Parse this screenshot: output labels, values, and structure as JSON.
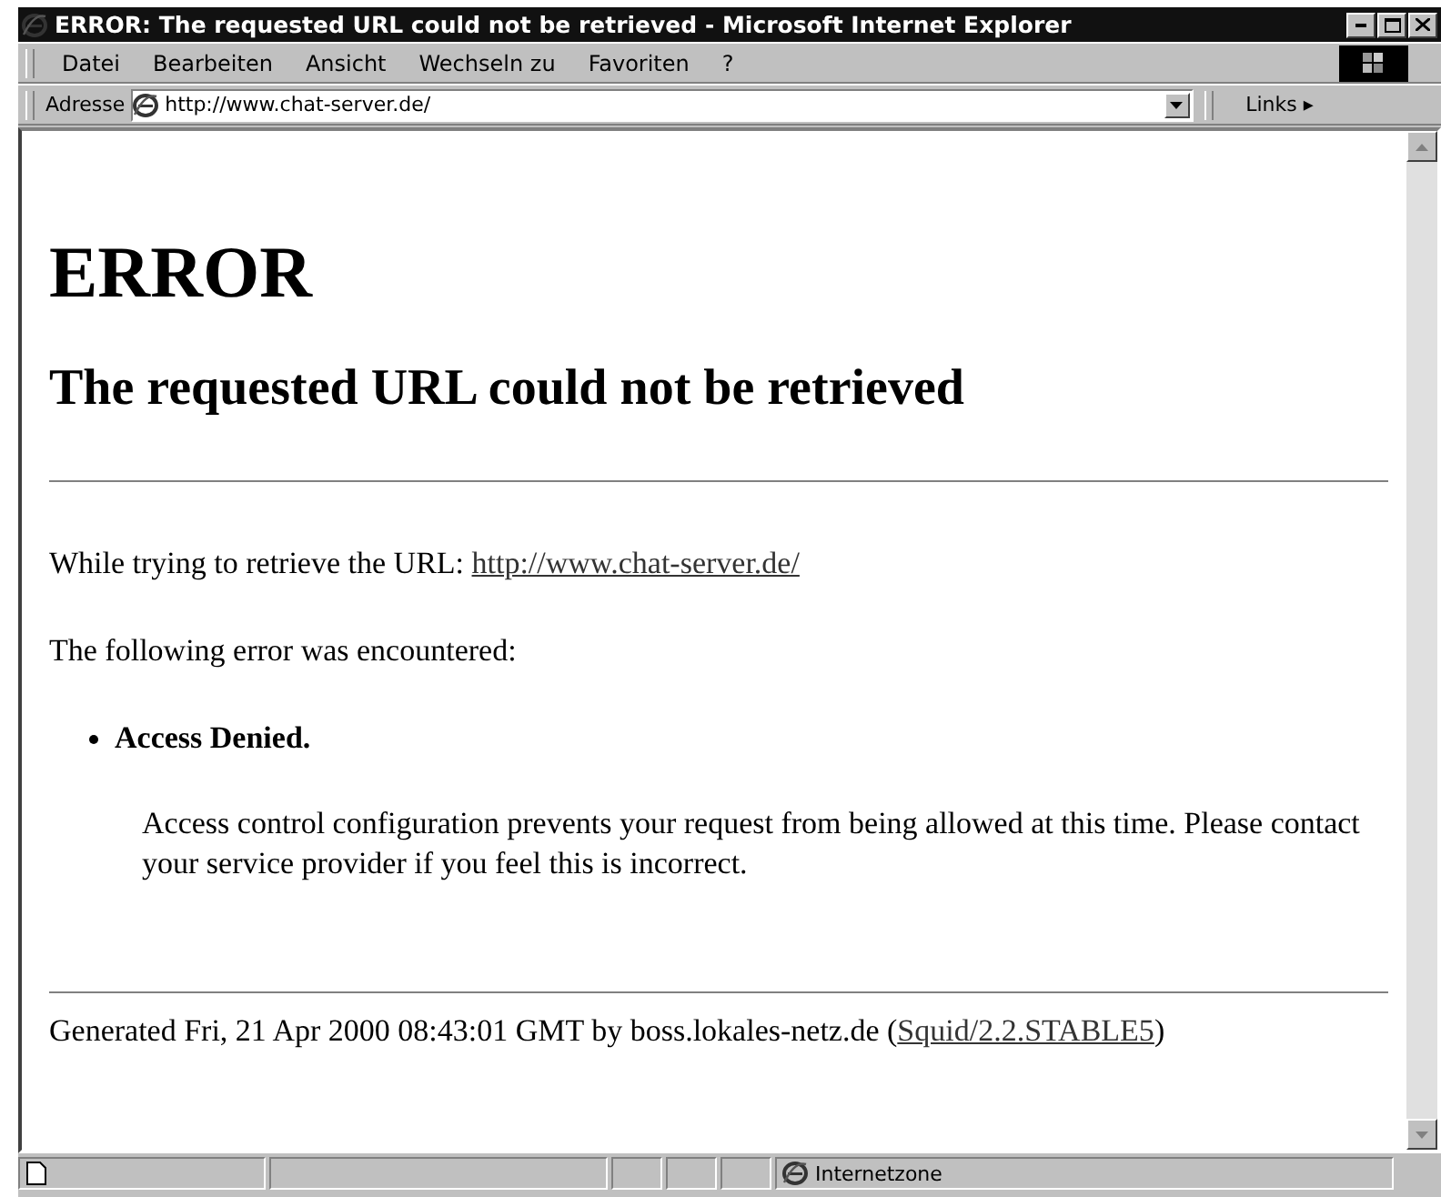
{
  "window": {
    "title": "ERROR: The requested URL could not be retrieved - Microsoft Internet Explorer"
  },
  "menu": [
    "Datei",
    "Bearbeiten",
    "Ansicht",
    "Wechseln zu",
    "Favoriten",
    "?"
  ],
  "address_bar": {
    "label": "Adresse",
    "value": "http://www.chat-server.de/",
    "links": "Links",
    "links_arrow": "▸"
  },
  "page": {
    "heading": "ERROR",
    "subheading": "The requested URL could not be retrieved",
    "url_line": {
      "text": "While trying to retrieve the URL:",
      "link": "http://www.chat-server.de/"
    },
    "error_intro": "The following error was encountered:",
    "error_title": "Access Denied.",
    "error_text": "Access control configuration prevents your request from being allowed at this time. Please contact your service provider if you feel this is incorrect.",
    "footer": {
      "text": "Generated Fri, 21 Apr 2000 08:43:01 GMT by boss.lokales-netz.de (",
      "link": "Squid/2.2.STABLE5",
      "after": ")"
    }
  },
  "status_bar": {
    "zone": "Internetzone"
  }
}
